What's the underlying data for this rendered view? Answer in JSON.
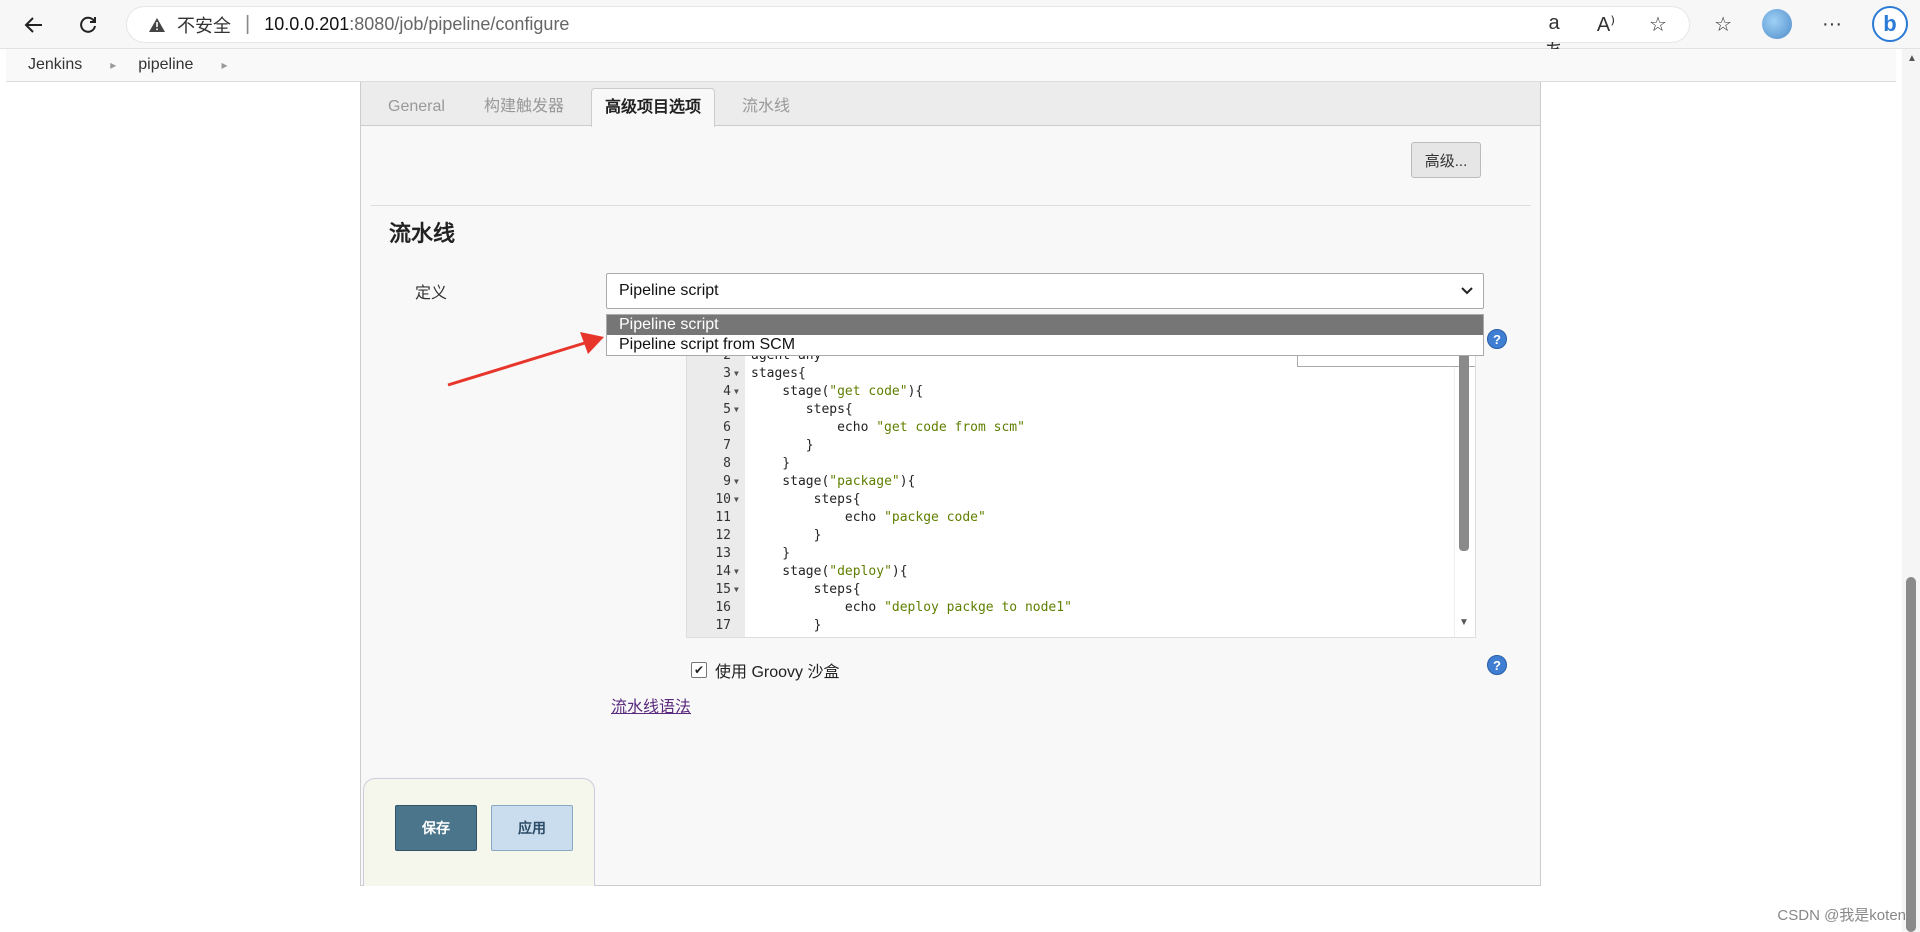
{
  "browser": {
    "insecure_label": "不安全",
    "host": "10.0.0.201",
    "path": ":8080/job/pipeline/configure"
  },
  "breadcrumb": [
    "Jenkins",
    "pipeline"
  ],
  "tabs": [
    {
      "label": "General",
      "active": false
    },
    {
      "label": "构建触发器",
      "active": false
    },
    {
      "label": "高级项目选项",
      "active": true
    },
    {
      "label": "流水线",
      "active": false
    }
  ],
  "advanced_button": "高级...",
  "section_title": "流水线",
  "definition": {
    "label": "定义",
    "selected": "Pipeline script",
    "options": [
      "Pipeline script",
      "Pipeline script from SCM"
    ]
  },
  "code_lines": [
    {
      "n": "2",
      "fold": false,
      "text": "agent any"
    },
    {
      "n": "3",
      "fold": true,
      "text": "stages{"
    },
    {
      "n": "4",
      "fold": true,
      "text": "    stage(\"get code\"){"
    },
    {
      "n": "5",
      "fold": true,
      "text": "       steps{"
    },
    {
      "n": "6",
      "fold": false,
      "text": "           echo \"get code from scm\""
    },
    {
      "n": "7",
      "fold": false,
      "text": "       }"
    },
    {
      "n": "8",
      "fold": false,
      "text": "    }"
    },
    {
      "n": "9",
      "fold": true,
      "text": "    stage(\"package\"){"
    },
    {
      "n": "10",
      "fold": true,
      "text": "        steps{"
    },
    {
      "n": "11",
      "fold": false,
      "text": "            echo \"packge code\""
    },
    {
      "n": "12",
      "fold": false,
      "text": "        }"
    },
    {
      "n": "13",
      "fold": false,
      "text": "    }"
    },
    {
      "n": "14",
      "fold": true,
      "text": "    stage(\"deploy\"){"
    },
    {
      "n": "15",
      "fold": true,
      "text": "        steps{"
    },
    {
      "n": "16",
      "fold": false,
      "text": "            echo \"deploy packge to node1\""
    },
    {
      "n": "17",
      "fold": false,
      "text": "        }"
    }
  ],
  "groovy_sandbox": {
    "label": "使用 Groovy 沙盒",
    "checked": true
  },
  "syntax_link": "流水线语法",
  "save_button": "保存",
  "apply_button": "应用",
  "watermark": "CSDN @我是koten",
  "colors": {
    "save": "#4b758b",
    "apply": "#c9ddee",
    "arrow": "#e8352b",
    "dropdown_selected": "#767676"
  },
  "icons": [
    "back-arrow-icon",
    "refresh-icon",
    "warning-icon",
    "read-aloud-icon",
    "favorite-star-icon",
    "collections-icon",
    "more-icon",
    "help-icon",
    "red-arrow-annotation"
  ]
}
